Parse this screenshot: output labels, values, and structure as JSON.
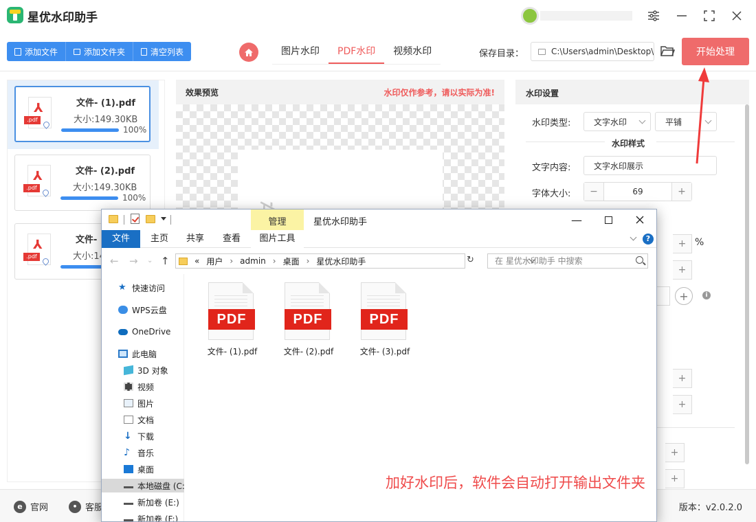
{
  "app": {
    "title": "星优水印助手"
  },
  "toolbar": {
    "buttons": [
      {
        "label": "添加文件",
        "icon": "file-icon"
      },
      {
        "label": "添加文件夹",
        "icon": "folder-icon"
      },
      {
        "label": "清空列表",
        "icon": "trash-icon"
      }
    ],
    "tabs": [
      {
        "label": "图片水印",
        "active": false
      },
      {
        "label": "PDF水印",
        "active": true
      },
      {
        "label": "视频水印",
        "active": false
      }
    ],
    "save_label": "保存目录：",
    "save_path": "C:\\Users\\admin\\Desktop\\",
    "start_label": "开始处理"
  },
  "files": [
    {
      "name": "文件- (1).pdf",
      "size": "大小:149.30KB",
      "progress": 100,
      "progress_text": "100%",
      "selected": true
    },
    {
      "name": "文件- (2).pdf",
      "size": "大小:149.30KB",
      "progress": 100,
      "progress_text": "100%",
      "selected": false
    },
    {
      "name": "文件-",
      "size": "大小:14",
      "progress": 100,
      "progress_text": "",
      "selected": false
    }
  ],
  "preview": {
    "title": "效果预览",
    "note": "水印仅作参考，请以实际为准!",
    "watermark_text": "文字水印展"
  },
  "settings": {
    "title": "水印设置",
    "type_label": "水印类型:",
    "type_value": "文字水印",
    "layout_value": "平铺",
    "section_title": "水印样式",
    "content_label": "文字内容:",
    "content_value": "文字水印展示",
    "font_size_label": "字体大小:",
    "font_size_value": "69",
    "percent_sign": "%"
  },
  "status": {
    "official_site": "官网",
    "support": "客服",
    "version": "版本：v2.0.2.0"
  },
  "explorer": {
    "manage_tab": "管理",
    "title": "星优水印助手",
    "ribbon_tabs": [
      "文件",
      "主页",
      "共享",
      "查看",
      "图片工具"
    ],
    "breadcrumb": [
      "用户",
      "admin",
      "桌面",
      "星优水印助手"
    ],
    "breadcrumb_prefix": "«",
    "search_placeholder": "在 星优水印助手 中搜索",
    "nav_items": [
      {
        "label": "快速访问",
        "icon": "star-icon"
      },
      {
        "label": "WPS云盘",
        "icon": "cloud-icon"
      },
      {
        "label": "OneDrive",
        "icon": "onedrive-icon"
      },
      {
        "label": "此电脑",
        "icon": "computer-icon"
      },
      {
        "label": "3D 对象",
        "icon": "cube-icon"
      },
      {
        "label": "视频",
        "icon": "video-icon"
      },
      {
        "label": "图片",
        "icon": "picture-icon"
      },
      {
        "label": "文档",
        "icon": "document-icon"
      },
      {
        "label": "下载",
        "icon": "download-icon"
      },
      {
        "label": "音乐",
        "icon": "music-icon"
      },
      {
        "label": "桌面",
        "icon": "desktop-icon"
      },
      {
        "label": "本地磁盘 (C:",
        "icon": "drive-icon",
        "selected": true
      },
      {
        "label": "新加卷 (E:)",
        "icon": "drive-icon"
      },
      {
        "label": "新加卷 (F:)",
        "icon": "drive-icon"
      }
    ],
    "files": [
      {
        "label": "文件- (1).pdf",
        "badge": "PDF"
      },
      {
        "label": "文件- (2).pdf",
        "badge": "PDF"
      },
      {
        "label": "文件- (3).pdf",
        "badge": "PDF"
      }
    ],
    "annotation": "加好水印后，软件会自动打开输出文件夹"
  }
}
